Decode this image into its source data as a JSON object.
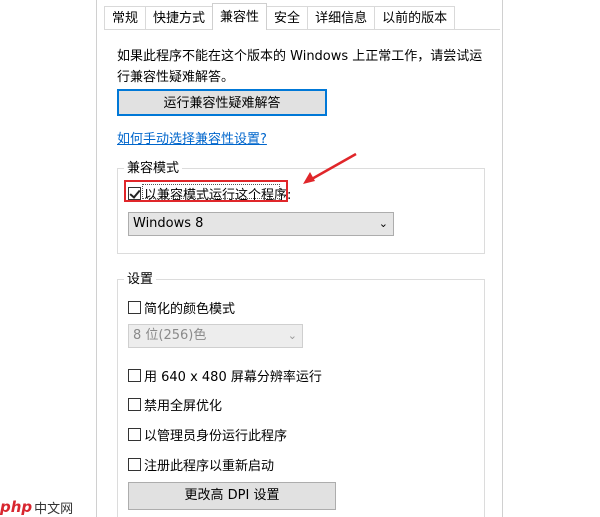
{
  "tabs": [
    {
      "label": "常规",
      "active": false
    },
    {
      "label": "快捷方式",
      "active": false
    },
    {
      "label": "兼容性",
      "active": true
    },
    {
      "label": "安全",
      "active": false
    },
    {
      "label": "详细信息",
      "active": false
    },
    {
      "label": "以前的版本",
      "active": false
    }
  ],
  "intro_text": "如果此程序不能在这个版本的 Windows 上正常工作，请尝试运行兼容性疑难解答。",
  "troubleshoot_button": "运行兼容性疑难解答",
  "help_link": "如何手动选择兼容性设置?",
  "compat_mode": {
    "legend": "兼容模式",
    "checkbox_label": "以兼容模式运行这个程序:",
    "checked": true,
    "selected_os": "Windows 8"
  },
  "settings": {
    "legend": "设置",
    "reduced_color": {
      "label": "简化的颜色模式",
      "checked": false
    },
    "color_select": "8 位(256)色",
    "res_640": {
      "label": "用 640 x 480 屏幕分辨率运行",
      "checked": false
    },
    "disable_fullscreen": {
      "label": "禁用全屏优化",
      "checked": false
    },
    "run_as_admin": {
      "label": "以管理员身份运行此程序",
      "checked": false
    },
    "register_restart": {
      "label": "注册此程序以重新启动",
      "checked": false
    },
    "dpi_button": "更改高 DPI 设置"
  },
  "watermark": {
    "logo": "php",
    "text": "中文网"
  },
  "colors": {
    "accent": "#0078d7",
    "highlight": "#e0262a",
    "link": "#0066cc"
  }
}
